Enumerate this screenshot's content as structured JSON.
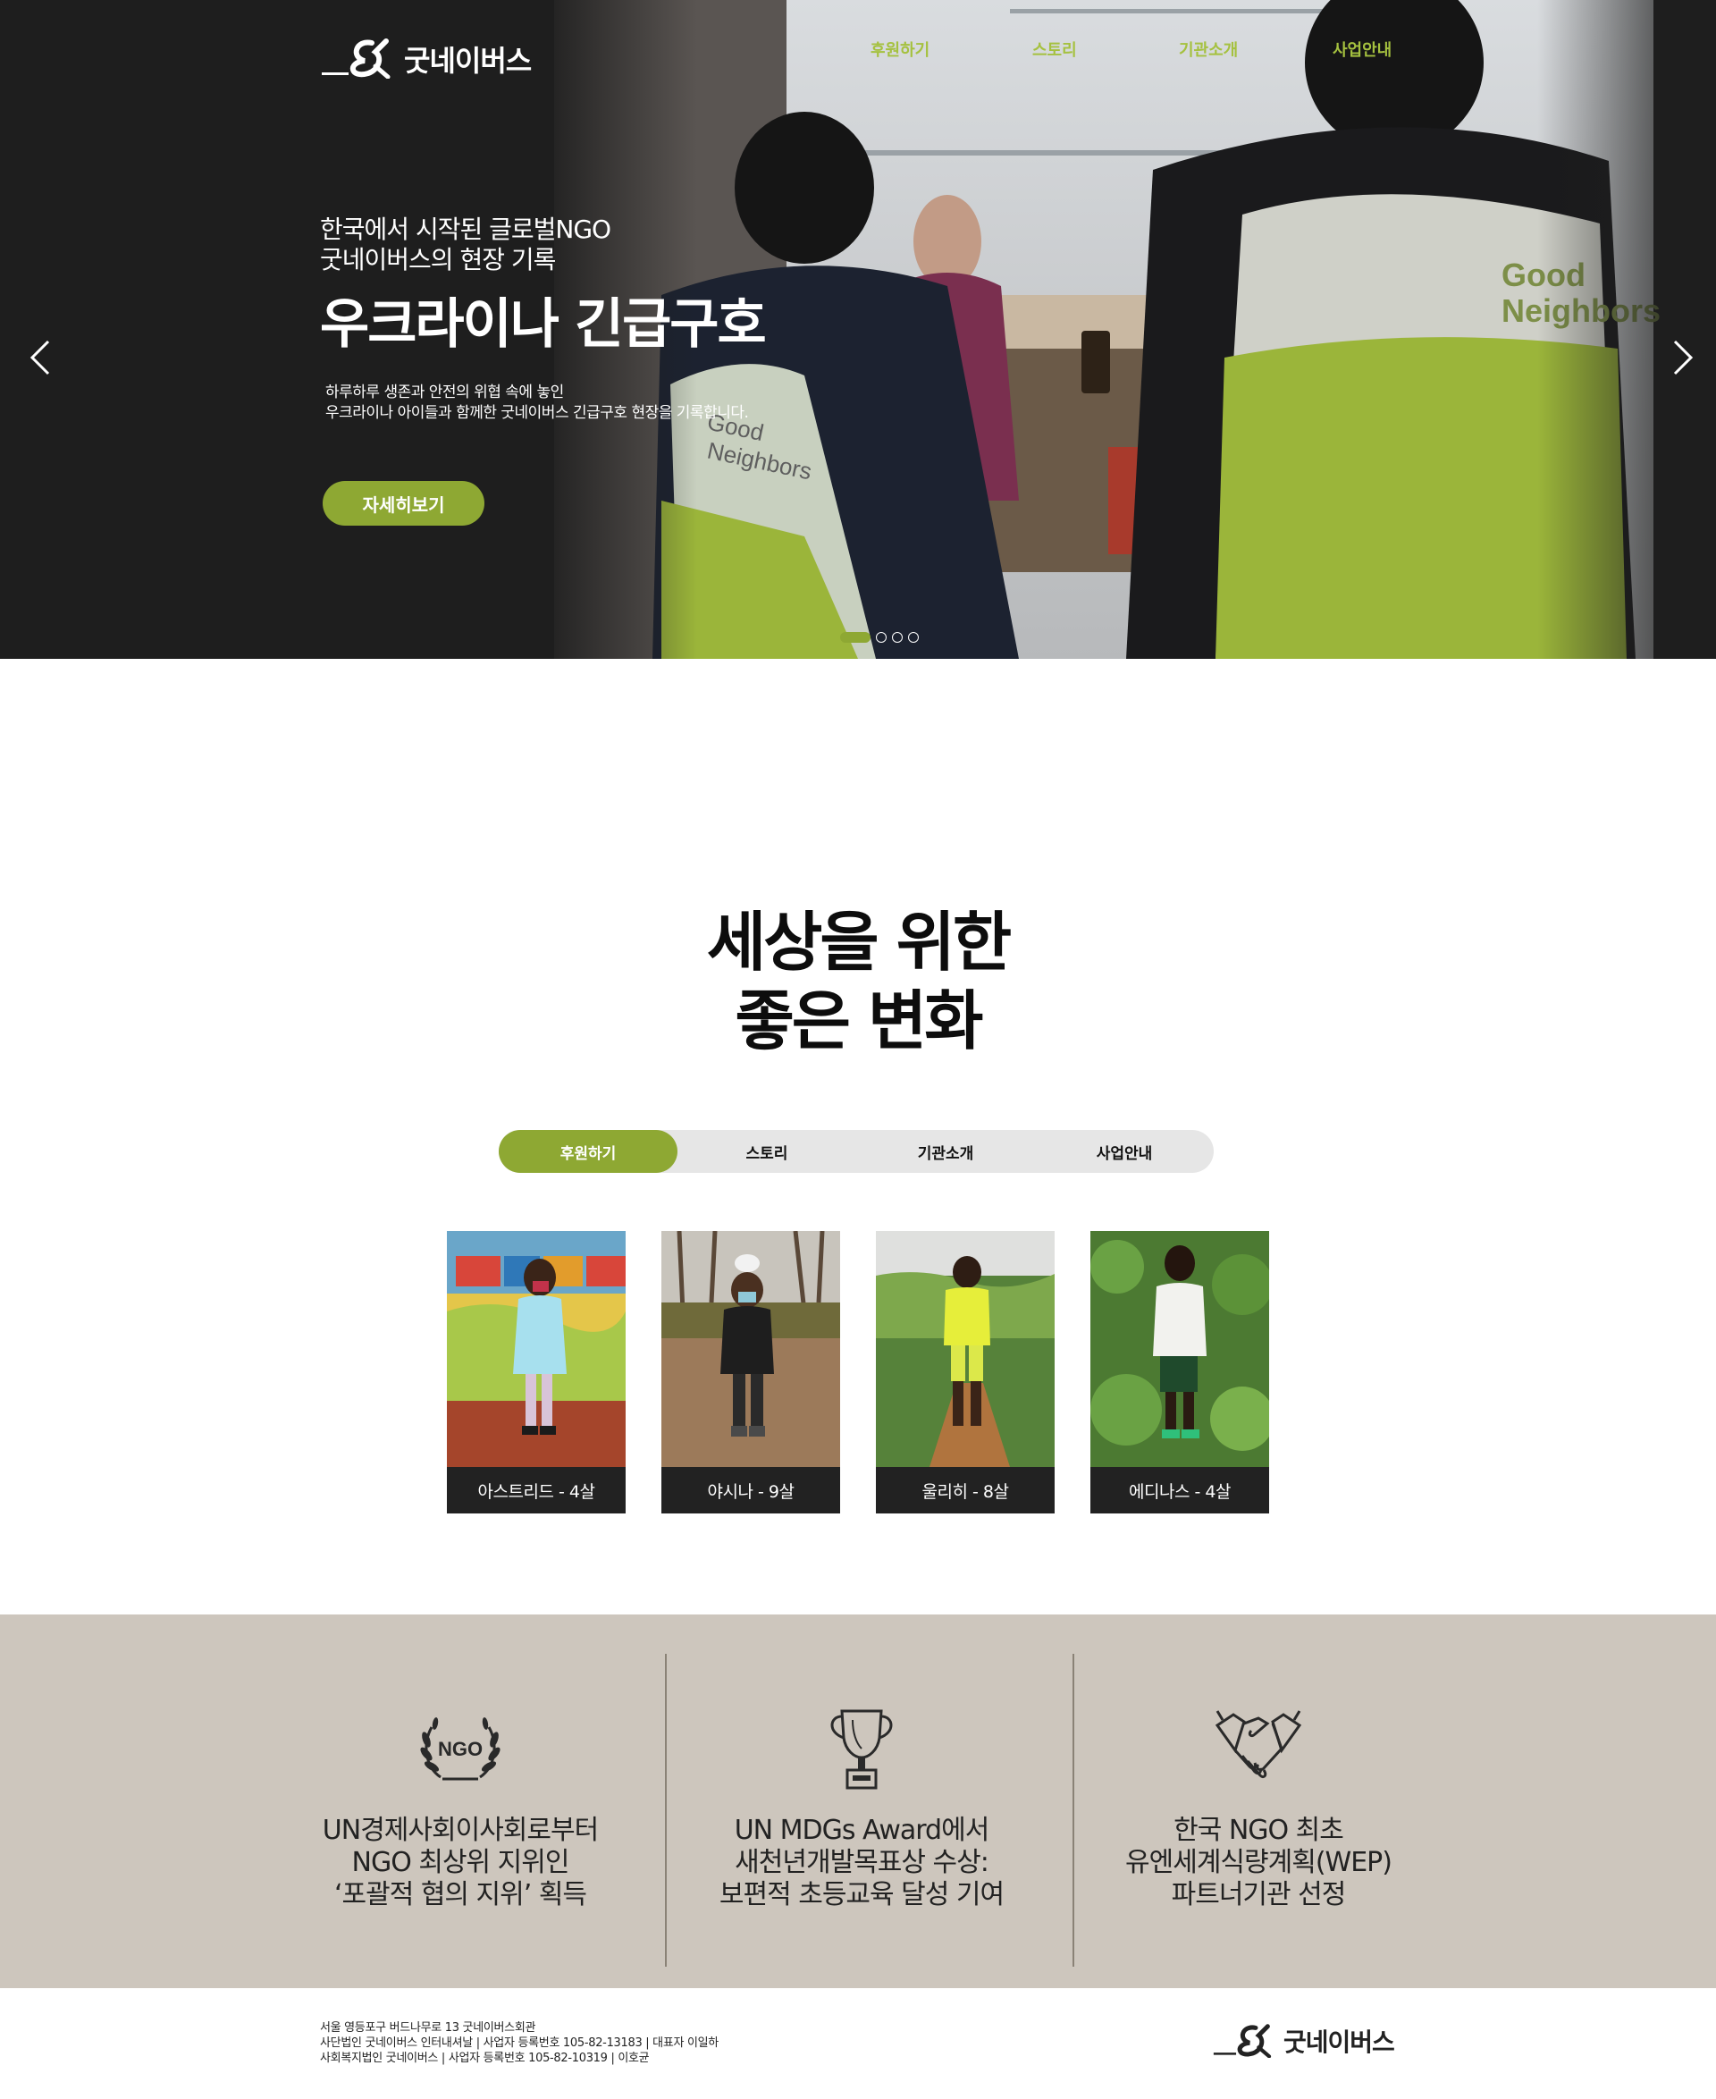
{
  "brand": {
    "name": "굿네이버스",
    "accent": "#8ea833",
    "nav_color": "#a5c13f"
  },
  "nav": {
    "items": [
      "후원하기",
      "스토리",
      "기관소개",
      "사업안내"
    ]
  },
  "hero": {
    "subtitle": "한국에서 시작된 글로벌NGO\n굿네이버스의 현장 기록",
    "title": "우크라이나 긴급구호",
    "description": "하루하루 생존과 안전의 위협 속에 놓인\n우크라이나 아이들과 함께한 굿네이버스 긴급구호 현장을 기록합니다.",
    "button_label": "자세히보기",
    "vest_text_1": "Good\nNeighbors",
    "vest_text_2": "Good\nNeighbors",
    "slides_total": 4,
    "active_slide": 1
  },
  "intro": {
    "title": "세상을 위한\n좋은 변화"
  },
  "tabs": {
    "items": [
      "후원하기",
      "스토리",
      "기관소개",
      "사업안내"
    ],
    "active_index": 0
  },
  "children": [
    {
      "caption": "아스트리드 - 4살"
    },
    {
      "caption": "야시나 - 9살"
    },
    {
      "caption": "울리히 - 8살"
    },
    {
      "caption": "에디나스 - 4살"
    }
  ],
  "achievements": [
    {
      "icon": "ngo-laurel-icon",
      "badge": "NGO",
      "text": "UN경제사회이사회로부터\nNGO 최상위 지위인\n‘포괄적 협의 지위’ 획득"
    },
    {
      "icon": "trophy-icon",
      "text": "UN MDGs Award에서\n새천년개발목표상 수상:\n보편적 초등교육 달성 기여"
    },
    {
      "icon": "handshake-icon",
      "text": "한국 NGO 최초\n유엔세계식량계획(WEP)\n파트너기관 선정"
    }
  ],
  "footer": {
    "info": "서울 영등포구 버드나무로 13 굿네이버스회관\n사단법인 굿네이버스 인터내셔날 | 사업자 등록번호 105-82-13183 | 대표자 이일하\n사회복지법인 굿네이버스 | 사업자 등록번호 105-82-10319 | 이호균"
  }
}
